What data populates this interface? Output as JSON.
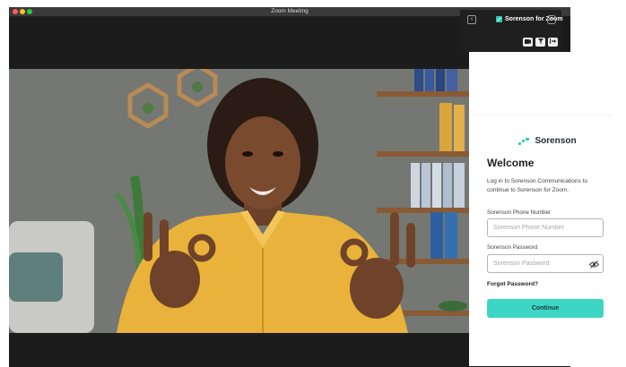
{
  "window": {
    "title": "Zoom Meeting"
  },
  "panel": {
    "title": "Sorenson for Zoom",
    "back_icon": "chevron-left-icon",
    "more_icon": "ellipsis-icon",
    "toolbar_icons": [
      "video-icon",
      "filter-icon",
      "exit-icon"
    ]
  },
  "login": {
    "brand": "Sorenson",
    "heading": "Welcome",
    "intro": "Log in to Sorenson Communications to continue to Sorenson for Zoom.",
    "phone_label": "Sorenson Phone Number",
    "phone_placeholder": "Sorenson Phone Number",
    "phone_value": "",
    "password_label": "Sorenson Password",
    "password_placeholder": "Sorenson Password",
    "password_value": "",
    "forgot": "Forgot Password?",
    "continue": "Continue"
  },
  "colors": {
    "accent": "#3dd6c4",
    "header_bg": "#1f1f1f"
  }
}
